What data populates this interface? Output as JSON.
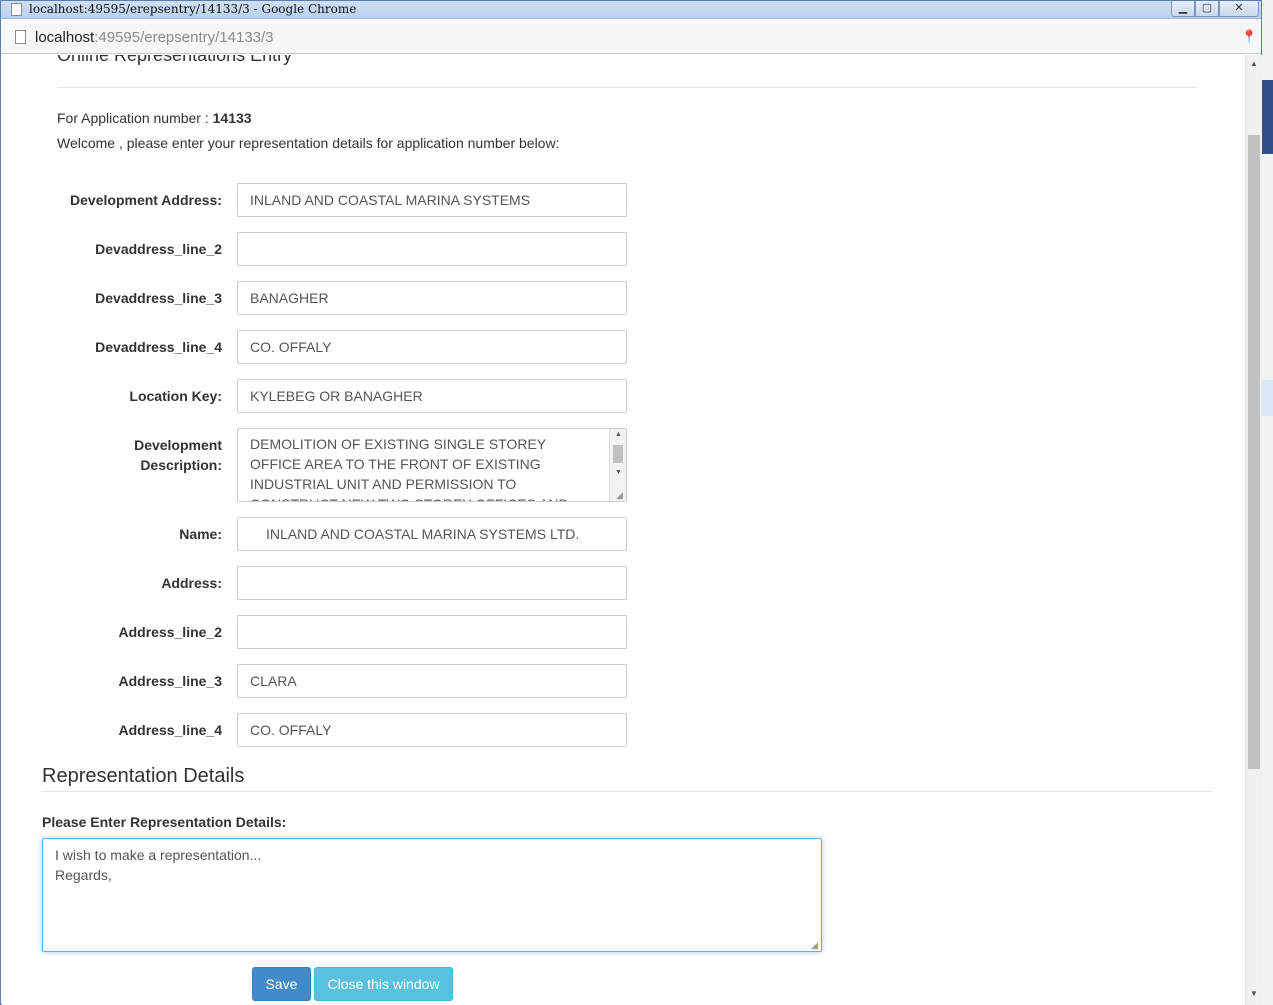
{
  "browser": {
    "window_title": "localhost:49595/erepsentry/14133/3 - Google Chrome",
    "url_host": "localhost",
    "url_rest": ":49595/erepsentry/14133/3",
    "controls": {
      "minimize": "▁",
      "maximize": "▢",
      "close": "✕"
    }
  },
  "page": {
    "title": "Online Representations Entry",
    "application_prefix": "For Application number : ",
    "application_number": "14133",
    "welcome": "Welcome , please enter your representation details for application number below:"
  },
  "fields": {
    "development_address": {
      "label": "Development Address:",
      "value": "INLAND AND COASTAL MARINA SYSTEMS"
    },
    "devaddress_line_2": {
      "label": "Devaddress_line_2",
      "value": ""
    },
    "devaddress_line_3": {
      "label": "Devaddress_line_3",
      "value": "BANAGHER"
    },
    "devaddress_line_4": {
      "label": "Devaddress_line_4",
      "value": "CO. OFFALY"
    },
    "location_key": {
      "label": "Location Key:",
      "value": "KYLEBEG OR BANAGHER"
    },
    "development_description": {
      "label_line1": "Development",
      "label_line2": "Description:",
      "value": "DEMOLITION OF EXISTING SINGLE STOREY OFFICE AREA TO THE FRONT OF EXISTING INDUSTRIAL UNIT AND PERMISSION TO CONSTRUCT NEW TWO STOREY OFFICES AND"
    },
    "name": {
      "label": "Name:",
      "value": "INLAND AND COASTAL MARINA SYSTEMS LTD."
    },
    "address": {
      "label": "Address:",
      "value": ""
    },
    "address_line_2": {
      "label": "Address_line_2",
      "value": ""
    },
    "address_line_3": {
      "label": "Address_line_3",
      "value": "CLARA"
    },
    "address_line_4": {
      "label": "Address_line_4",
      "value": "CO. OFFALY"
    }
  },
  "representation": {
    "section_title": "Representation Details",
    "label": "Please Enter Representation Details:",
    "value": "I wish to make a representation...\nRegards,"
  },
  "buttons": {
    "save": "Save",
    "close": "Close this window"
  },
  "colors": {
    "primary": "#428bca",
    "info": "#5bc0de",
    "focus_border": "#66afe9"
  }
}
